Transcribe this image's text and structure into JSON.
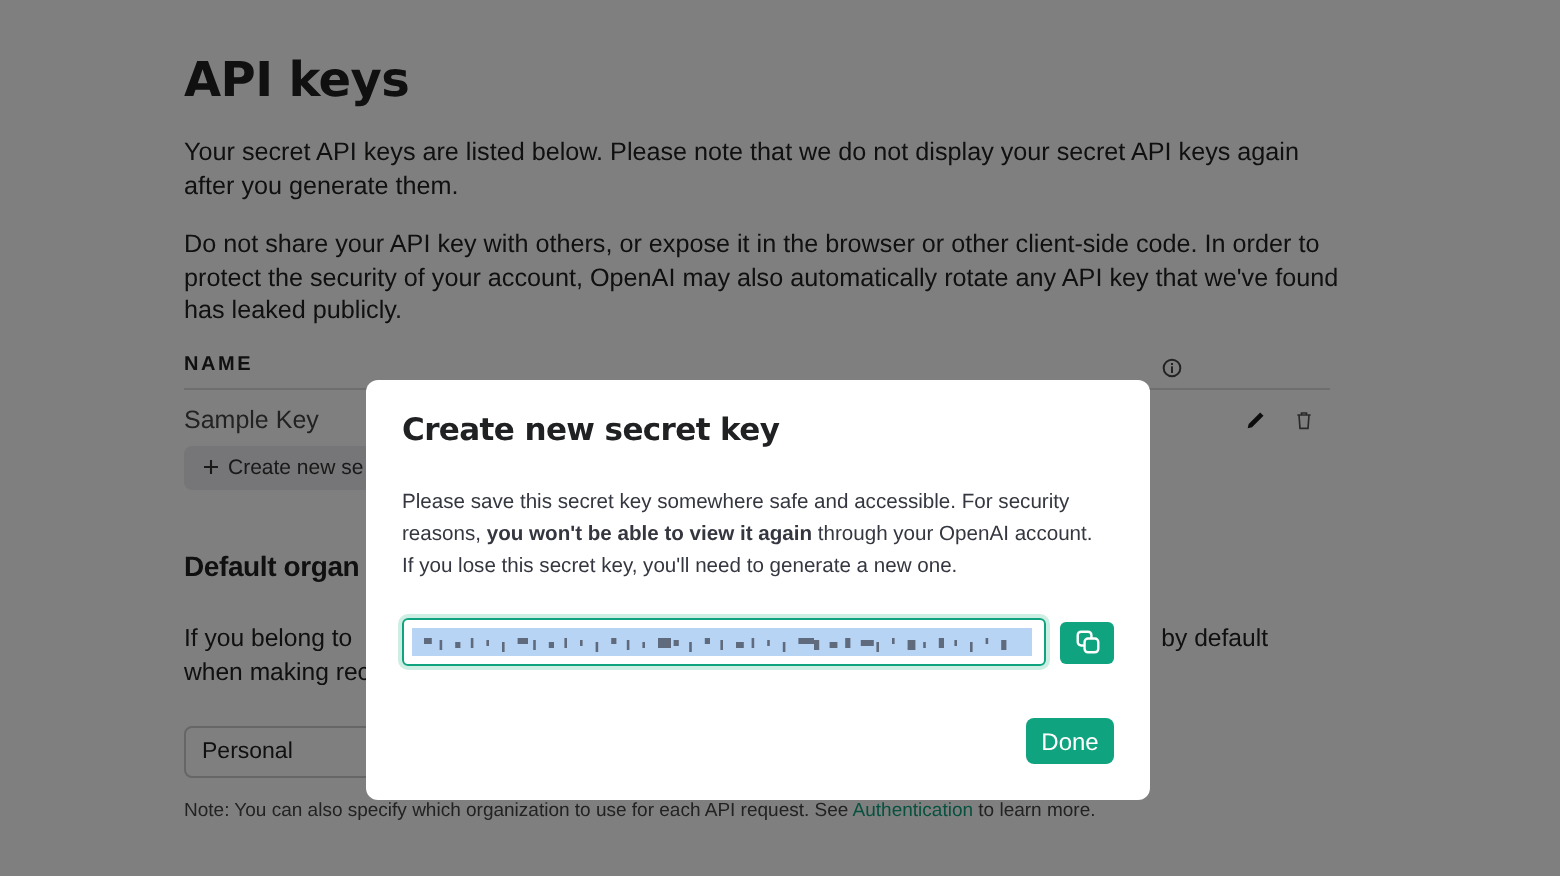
{
  "page": {
    "title": "API keys",
    "paragraphs": [
      "Your secret API keys are listed below. Please note that we do not display your secret API keys again after you generate them.",
      "Do not share your API key with others, or expose it in the browser or other client-side code. In order to protect the security of your account, OpenAI may also automatically rotate any API key that we've found has leaked publicly."
    ],
    "table": {
      "columns": [
        "NAME"
      ],
      "rows": [
        {
          "name": "Sample Key"
        }
      ]
    },
    "create_button": "Create new se",
    "section": {
      "title": "Default organ",
      "line_1_start": "If you belong to",
      "line_1_end": "by default",
      "line_2": "when making rec",
      "select_value": "Personal"
    },
    "note": {
      "before": "Note: You can also specify which organization to use for each API request. See",
      "link": "Authentication",
      "after": "to learn more."
    }
  },
  "dialog": {
    "title": "Create new secret key",
    "text": "Please save this secret key somewhere safe and accessible. For security reasons, **you won't be able to view it again** through your OpenAI account. If you lose this secret key, you'll need to generate a new one.",
    "done_button": "Done"
  }
}
